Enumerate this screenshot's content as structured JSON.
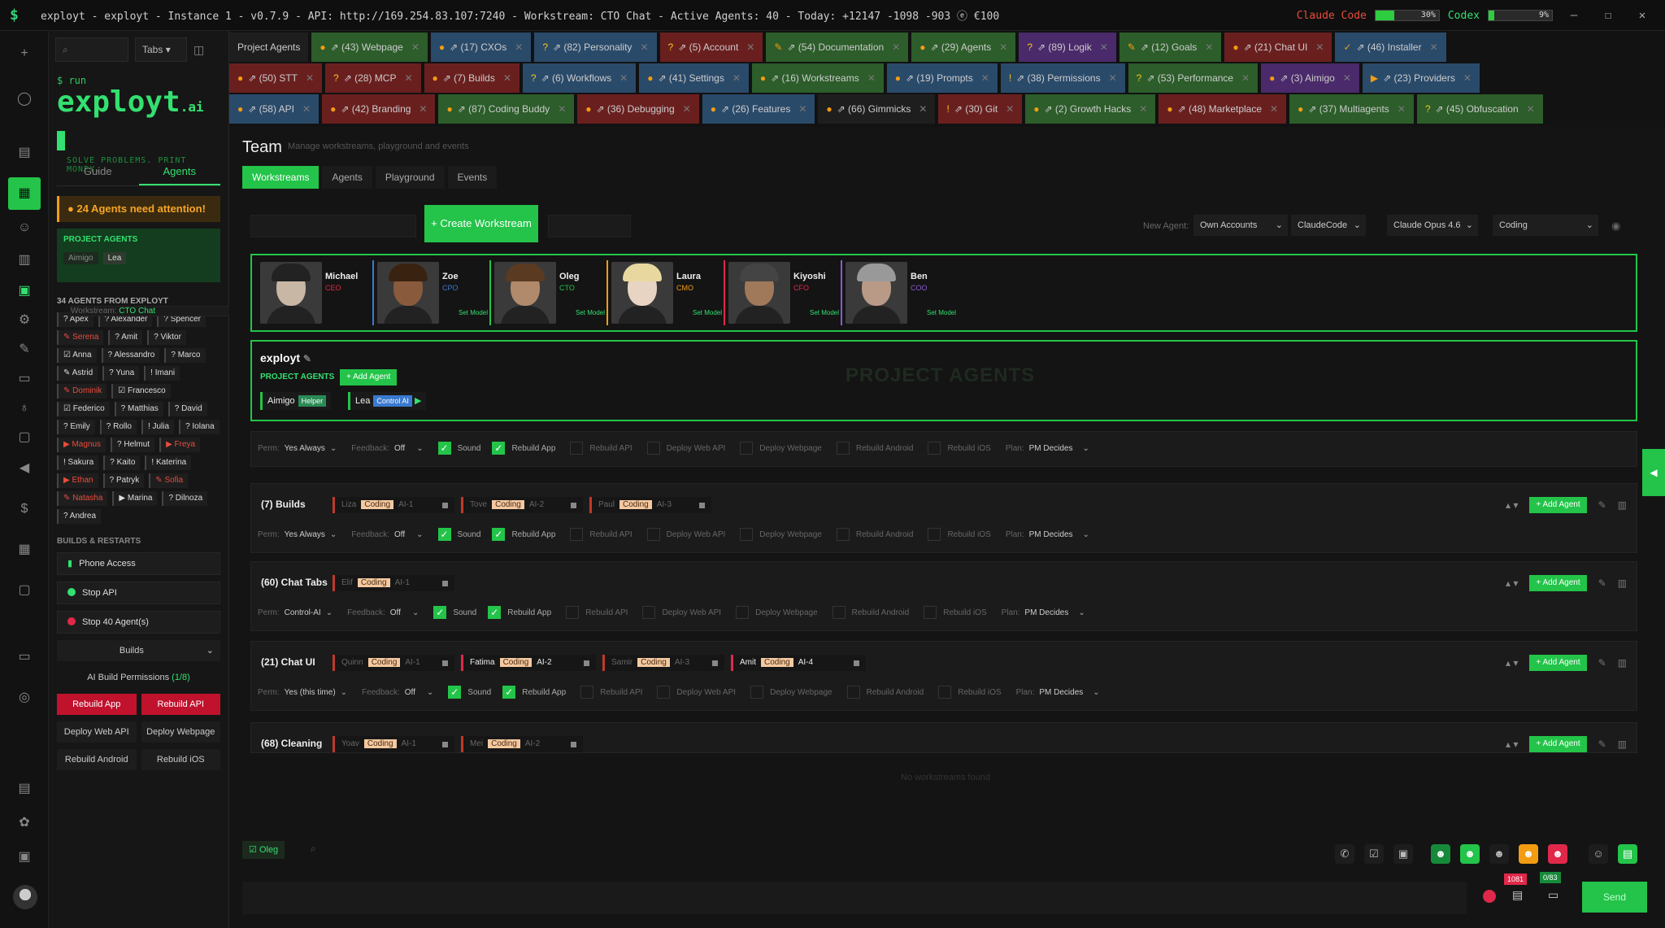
{
  "titlebar": {
    "logo": "$",
    "title": "exployt - exployt - Instance 1 - v0.7.9 - API: http://169.254.83.107:7240 - Workstream: CTO Chat - Active Agents: 40 - Today: +12147 -1098 -903 ⓔ €100",
    "claude_label": "Claude Code",
    "claude_pct": "30%",
    "claude_val": 0.3,
    "codex_label": "Codex",
    "codex_pct": "9%",
    "codex_val": 0.09,
    "min": "—",
    "max": "☐",
    "close": "✕",
    "claude_color": "#e74c3c",
    "codex_color": "#33e070"
  },
  "sidebar": {
    "search_placeholder": "",
    "tabs_label": "Tabs",
    "run": "$ run",
    "brand": "exployt",
    "brand_sfx": ".ai",
    "tagline": "SOLVE PROBLEMS. PRINT MONEY.",
    "subtabs": [
      "Guide",
      "Agents"
    ],
    "attention": "24 Agents need attention!",
    "project_agents_h": "PROJECT AGENTS",
    "project_agents": [
      "Aimigo",
      "Lea"
    ],
    "agents_from": "34 AGENTS FROM EXPLOYT",
    "workstream_lbl": "Workstream:",
    "workstream": "CTO Chat",
    "agents": [
      {
        "n": "? Apex",
        "r": false
      },
      {
        "n": "? Alexander",
        "r": false
      },
      {
        "n": "? Spencer",
        "r": false
      },
      {
        "n": "✎ Serena",
        "r": true
      },
      {
        "n": "? Amit",
        "r": false
      },
      {
        "n": "? Viktor",
        "r": false
      },
      {
        "n": "☑ Anna",
        "r": false
      },
      {
        "n": "? Alessandro",
        "r": false
      },
      {
        "n": "? Marco",
        "r": false
      },
      {
        "n": "✎ Astrid",
        "r": false
      },
      {
        "n": "? Yuna",
        "r": false
      },
      {
        "n": "! Imani",
        "r": false
      },
      {
        "n": "✎ Dominik",
        "r": true
      },
      {
        "n": "☑ Francesco",
        "r": false
      },
      {
        "n": "☑ Federico",
        "r": false
      },
      {
        "n": "? Matthias",
        "r": false
      },
      {
        "n": "? David",
        "r": false
      },
      {
        "n": "? Emily",
        "r": false
      },
      {
        "n": "? Rollo",
        "r": false
      },
      {
        "n": "! Julia",
        "r": false
      },
      {
        "n": "? Iolana",
        "r": false
      },
      {
        "n": "▶ Magnus",
        "r": true
      },
      {
        "n": "? Helmut",
        "r": false
      },
      {
        "n": "▶ Freya",
        "r": true
      },
      {
        "n": "! Sakura",
        "r": false
      },
      {
        "n": "? Kaito",
        "r": false
      },
      {
        "n": "! Katerina",
        "r": false
      },
      {
        "n": "▶ Ethan",
        "r": true
      },
      {
        "n": "? Patryk",
        "r": false
      },
      {
        "n": "✎ Sofia",
        "r": true
      },
      {
        "n": "✎ Natasha",
        "r": true
      },
      {
        "n": "▶ Marina",
        "r": false
      },
      {
        "n": "? Dilnoza",
        "r": false
      },
      {
        "n": "? Andrea",
        "r": false
      }
    ],
    "builds_title": "BUILDS & RESTARTS",
    "phone": "Phone Access",
    "stop_api": "Stop API",
    "stop_agents": "Stop 40 Agent(s)",
    "builds": "Builds",
    "perm_lbl": "AI Build Permissions",
    "perm_val": "(1/8)",
    "rebuild_app": "Rebuild App",
    "rebuild_api": "Rebuild API",
    "deploy_web_api": "Deploy Web API",
    "deploy_webpage": "Deploy Webpage",
    "rebuild_android": "Rebuild Android",
    "rebuild_ios": "Rebuild iOS"
  },
  "tabs": {
    "row1": [
      {
        "l": "Project Agents",
        "s": "",
        "c": "#1e1e1e"
      },
      {
        "l": "⇗ (43) Webpage",
        "s": "●",
        "c": "#2c5d2a"
      },
      {
        "l": "⇗ (17) CXOs",
        "s": "●",
        "c": "#2a4a6a"
      },
      {
        "l": "⇗ (82) Personality",
        "s": "?",
        "c": "#2a4a6a"
      },
      {
        "l": "⇗ (5) Account",
        "s": "?",
        "c": "#6a1f1f"
      },
      {
        "l": "⇗ (54) Documentation",
        "s": "✎",
        "c": "#2c5d2a"
      },
      {
        "l": "⇗ (29) Agents",
        "s": "●",
        "c": "#2c5d2a"
      },
      {
        "l": "⇗ (89) Logik",
        "s": "?",
        "c": "#4a2a6a"
      },
      {
        "l": "⇗ (12) Goals",
        "s": "✎",
        "c": "#2c5d2a"
      },
      {
        "l": "⇗ (21) Chat UI",
        "s": "●",
        "c": "#6a1f1f"
      },
      {
        "l": "⇗ (46) Installer",
        "s": "✓",
        "c": "#2a4a6a"
      }
    ],
    "row2": [
      {
        "l": "⇗ (50) STT",
        "s": "●",
        "c": "#6a1f1f"
      },
      {
        "l": "⇗ (28) MCP",
        "s": "?",
        "c": "#6a1f1f"
      },
      {
        "l": "⇗ (7) Builds",
        "s": "●",
        "c": "#6a1f1f"
      },
      {
        "l": "⇗ (6) Workflows",
        "s": "?",
        "c": "#2a4a6a"
      },
      {
        "l": "⇗ (41) Settings",
        "s": "●",
        "c": "#2a4a6a"
      },
      {
        "l": "⇗ (16) Workstreams",
        "s": "●",
        "c": "#2c5d2a"
      },
      {
        "l": "⇗ (19) Prompts",
        "s": "●",
        "c": "#2a4a6a"
      },
      {
        "l": "⇗ (38) Permissions",
        "s": "!",
        "c": "#2a4a6a"
      },
      {
        "l": "⇗ (53) Performance",
        "s": "?",
        "c": "#2c5d2a"
      },
      {
        "l": "⇗ (3) Aimigo",
        "s": "●",
        "c": "#4a2a6a"
      },
      {
        "l": "⇗ (23) Providers",
        "s": "▶",
        "c": "#2a4a6a"
      }
    ],
    "row3": [
      {
        "l": "⇗ (58) API",
        "s": "●",
        "c": "#2a4a6a"
      },
      {
        "l": "⇗ (42) Branding",
        "s": "●",
        "c": "#6a1f1f"
      },
      {
        "l": "⇗ (87) Coding Buddy",
        "s": "●",
        "c": "#2c5d2a"
      },
      {
        "l": "⇗ (36) Debugging",
        "s": "●",
        "c": "#6a1f1f"
      },
      {
        "l": "⇗ (26) Features",
        "s": "●",
        "c": "#2a4a6a"
      },
      {
        "l": "⇗ (66) Gimmicks",
        "s": "●",
        "c": "#1e1e1e"
      },
      {
        "l": "⇗ (30) Git",
        "s": "!",
        "c": "#6a1f1f"
      },
      {
        "l": "⇗ (2) Growth Hacks",
        "s": "●",
        "c": "#2c5d2a"
      },
      {
        "l": "⇗ (48) Marketplace",
        "s": "●",
        "c": "#6a1f1f"
      },
      {
        "l": "⇗ (37) Multiagents",
        "s": "●",
        "c": "#2c5d2a"
      },
      {
        "l": "⇗ (45) Obfuscation",
        "s": "?",
        "c": "#2c5d2a"
      }
    ]
  },
  "main": {
    "title": "Team",
    "subtitle": "Manage workstreams, playground and events",
    "tabs": [
      "Workstreams",
      "Agents",
      "Playground",
      "Events"
    ],
    "create": "+ Create Workstream",
    "new_agent_lbl": "New Agent:",
    "dd1": "Own Accounts",
    "dd2": "ClaudeCode",
    "dd3": "Claude Opus 4.6",
    "dd4": "Coding",
    "people": [
      {
        "name": "Michael",
        "role": "CEO",
        "set": ""
      },
      {
        "name": "Zoe",
        "role": "CPO",
        "set": "Set Model"
      },
      {
        "name": "Oleg",
        "role": "CTO",
        "set": "Set Model"
      },
      {
        "name": "Laura",
        "role": "CMO",
        "set": "Set Model"
      },
      {
        "name": "Kiyoshi",
        "role": "CFO",
        "set": "Set Model"
      },
      {
        "name": "Ben",
        "role": "COO",
        "set": "Set Model"
      }
    ],
    "exployt": {
      "name": "exployt",
      "pa": "PROJECT AGENTS",
      "add": "+ Add Agent",
      "wm": "PROJECT AGENTS",
      "a1": "Aimigo",
      "a1t": "Helper",
      "a2": "Lea",
      "a2t": "Control AI"
    },
    "opt": {
      "perm": "Perm:",
      "feedback": "Feedback:",
      "off": "Off",
      "sound": "Sound",
      "rapp": "Rebuild App",
      "rapi": "Rebuild API",
      "dwa": "Deploy Web API",
      "dwp": "Deploy Webpage",
      "ra": "Rebuild Android",
      "ri": "Rebuild iOS",
      "plan": "Plan:",
      "pm": "PM Decides",
      "coding": "Coding",
      "add": "+ Add Agent"
    },
    "ws": [
      {
        "title": "",
        "perm": "Yes Always",
        "slots": []
      },
      {
        "title": "(7) Builds",
        "perm": "Yes Always",
        "slots": [
          {
            "n": "Liza",
            "a": "AI-1"
          },
          {
            "n": "Tove",
            "a": "AI-2"
          },
          {
            "n": "Paul",
            "a": "AI-3"
          }
        ]
      },
      {
        "title": "(60) Chat Tabs",
        "perm": "Control-AI",
        "slots": [
          {
            "n": "Elif",
            "a": "AI-1"
          }
        ]
      },
      {
        "title": "(21) Chat UI",
        "perm": "Yes (this time)",
        "slots": [
          {
            "n": "Quinn",
            "a": "AI-1"
          },
          {
            "n": "Fatima",
            "a": "AI-2"
          },
          {
            "n": "Samir",
            "a": "AI-3"
          },
          {
            "n": "Amit",
            "a": "AI-4"
          }
        ]
      },
      {
        "title": "(68) Cleaning",
        "perm": "",
        "slots": [
          {
            "n": "Yoav",
            "a": "AI-1"
          },
          {
            "n": "Mei",
            "a": "AI-2"
          }
        ]
      }
    ],
    "no_ws": "No workstreams found"
  },
  "bottom": {
    "user": "Oleg",
    "send": "Send",
    "b1": "1081",
    "b2": "0/83"
  }
}
